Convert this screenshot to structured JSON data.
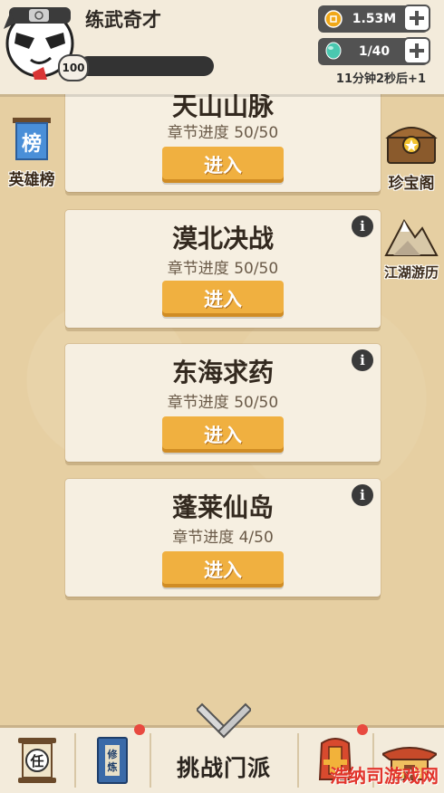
{
  "player": {
    "name": "练武奇才",
    "level": "100"
  },
  "resources": {
    "coins": {
      "value": "1.53M",
      "icon": "coin-icon"
    },
    "stamina": {
      "value": "1/40",
      "icon": "gem-icon"
    },
    "timer": "11分钟2秒后+1"
  },
  "side_left": [
    {
      "label": "英雄榜",
      "icon": "ranking-banner-icon",
      "glyph": "榜"
    }
  ],
  "side_right": [
    {
      "label": "珍宝阁",
      "icon": "treasure-chest-icon"
    },
    {
      "label": "江湖游历",
      "icon": "mountain-icon"
    }
  ],
  "chapters": [
    {
      "title": "天山山脉",
      "progress": "章节进度 50/50",
      "button": "进入"
    },
    {
      "title": "漠北决战",
      "progress": "章节进度 50/50",
      "button": "进入",
      "info": "i"
    },
    {
      "title": "东海求药",
      "progress": "章节进度 50/50",
      "button": "进入",
      "info": "i"
    },
    {
      "title": "蓬莱仙岛",
      "progress": "章节进度 4/50",
      "button": "进入",
      "info": "i"
    }
  ],
  "bottom_nav": {
    "task_glyph": "任",
    "train_glyph": "修炼",
    "main_label": "挑战门派"
  },
  "watermark": "浩纳司游戏网",
  "colors": {
    "button": "#f0b040",
    "background": "#e6cfa2",
    "card": "#f6efe1",
    "badge_dot": "#e8493f"
  }
}
